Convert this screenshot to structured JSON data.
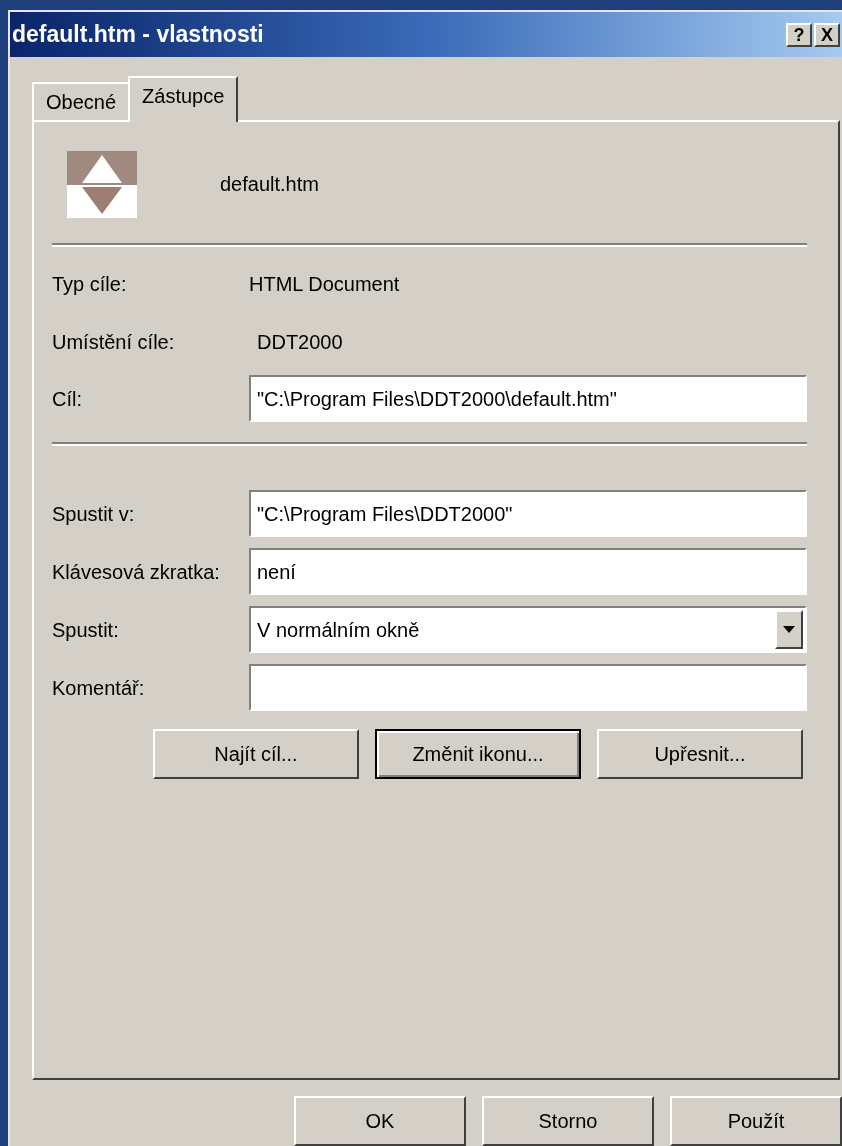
{
  "window": {
    "title": "default.htm - vlastnosti",
    "title_buttons": [
      "?",
      "X"
    ]
  },
  "tabs": [
    {
      "label": "Obecné",
      "selected": false
    },
    {
      "label": "Zástupce",
      "selected": true
    }
  ],
  "file_name": "default.htm",
  "info": [
    {
      "label": "Typ cíle:",
      "value": "HTML Document"
    },
    {
      "label": "Umístění cíle:",
      "value": "DDT2000"
    }
  ],
  "target": {
    "label": "Cíl:",
    "value": "\"C:\\Program Files\\DDT2000\\default.htm\""
  },
  "fields": [
    {
      "kind": "text",
      "label": "Spustit v:",
      "value": "\"C:\\Program Files\\DDT2000\""
    },
    {
      "kind": "text",
      "label": "Klávesová zkratka:",
      "value": "není"
    },
    {
      "kind": "dropdown",
      "label": "Spustit:",
      "value": "V normálním okně"
    },
    {
      "kind": "text",
      "label": "Komentář:"
    }
  ],
  "action_buttons": [
    {
      "label": "Najít cíl...",
      "default": false
    },
    {
      "label": "Změnit ikonu...",
      "default": true
    },
    {
      "label": "Upřesnit...",
      "default": false
    }
  ],
  "dialog_buttons": [
    "OK",
    "Storno",
    "Použít"
  ]
}
